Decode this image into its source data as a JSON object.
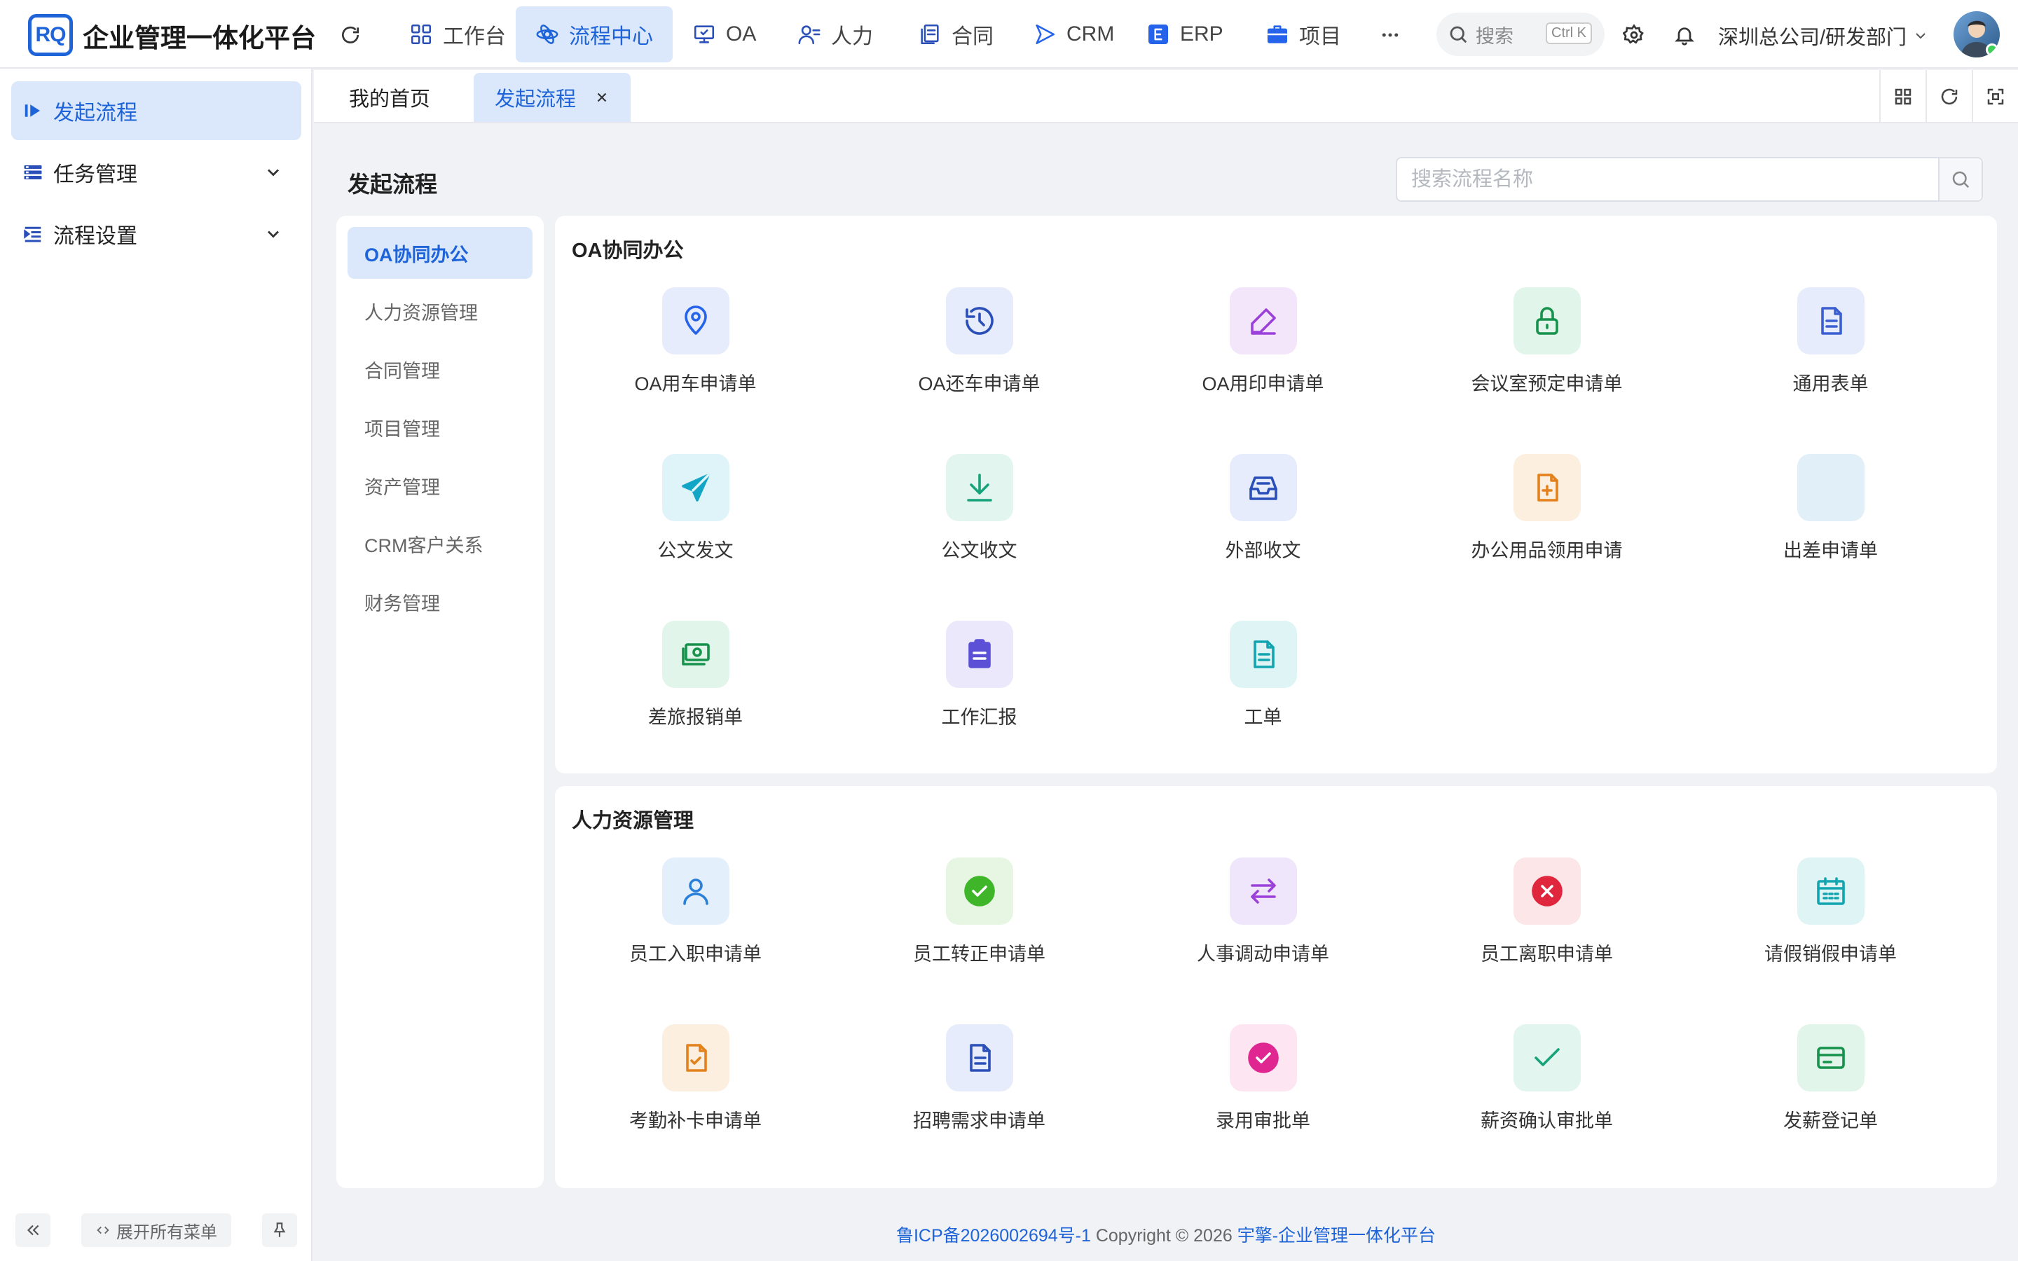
{
  "header": {
    "logo_text": "RQ",
    "title": "企业管理一体化平台",
    "nav": [
      {
        "label": "工作台",
        "icon": "dashboard-icon"
      },
      {
        "label": "流程中心",
        "icon": "workflow-icon",
        "active": true
      },
      {
        "label": "OA",
        "icon": "oa-icon"
      },
      {
        "label": "人力",
        "icon": "hr-icon"
      },
      {
        "label": "合同",
        "icon": "contract-icon"
      },
      {
        "label": "CRM",
        "icon": "crm-icon"
      },
      {
        "label": "ERP",
        "icon": "erp-icon"
      },
      {
        "label": "项目",
        "icon": "project-icon"
      }
    ],
    "search_label": "搜索",
    "search_shortcut": "Ctrl K",
    "org_label": "深圳总公司/研发部门"
  },
  "sidebar": {
    "items": [
      {
        "label": "发起流程",
        "active": true
      },
      {
        "label": "任务管理"
      },
      {
        "label": "流程设置"
      }
    ],
    "expand_all_label": "展开所有菜单"
  },
  "tabs": [
    {
      "label": "我的首页"
    },
    {
      "label": "发起流程",
      "active": true
    }
  ],
  "page": {
    "title": "发起流程",
    "search_placeholder": "搜索流程名称"
  },
  "categories": [
    {
      "label": "OA协同办公",
      "active": true
    },
    {
      "label": "人力资源管理"
    },
    {
      "label": "合同管理"
    },
    {
      "label": "项目管理"
    },
    {
      "label": "资产管理"
    },
    {
      "label": "CRM客户关系"
    },
    {
      "label": "财务管理"
    }
  ],
  "sections": [
    {
      "title": "OA协同办公",
      "items": [
        {
          "label": "OA用车申请单",
          "icon": "location-pin-icon",
          "color": "#2563eb",
          "bg": "#e6ecfb"
        },
        {
          "label": "OA还车申请单",
          "icon": "history-icon",
          "color": "#2a4fb8",
          "bg": "#e6ecfb"
        },
        {
          "label": "OA用印申请单",
          "icon": "pen-icon",
          "color": "#9b40d9",
          "bg": "#f3e6fb"
        },
        {
          "label": "会议室预定申请单",
          "icon": "lock-icon",
          "color": "#17924d",
          "bg": "#e2f5ea"
        },
        {
          "label": "通用表单",
          "icon": "document-icon",
          "color": "#3b5fd1",
          "bg": "#e6ecfb"
        },
        {
          "label": "公文发文",
          "icon": "paper-plane-icon",
          "color": "#12a5c6",
          "bg": "#def4f9"
        },
        {
          "label": "公文收文",
          "icon": "download-icon",
          "color": "#17a37a",
          "bg": "#e2f5ee"
        },
        {
          "label": "外部收文",
          "icon": "inbox-icon",
          "color": "#2a4fb8",
          "bg": "#e6ecfb"
        },
        {
          "label": "办公用品领用申请",
          "icon": "file-plus-icon",
          "color": "#e3811c",
          "bg": "#fcefe0"
        },
        {
          "label": "出差申请单",
          "icon": "blank-icon",
          "color": "#5aaad6",
          "bg": "#e1eff8"
        },
        {
          "label": "差旅报销单",
          "icon": "money-icon",
          "color": "#17924d",
          "bg": "#e2f5ea"
        },
        {
          "label": "工作汇报",
          "icon": "clipboard-icon",
          "color": "#5b50d6",
          "bg": "#ebe8fb"
        },
        {
          "label": "工单",
          "icon": "file-text-icon",
          "color": "#12a5b0",
          "bg": "#def4f5"
        }
      ]
    },
    {
      "title": "人力资源管理",
      "items": [
        {
          "label": "员工入职申请单",
          "icon": "user-icon",
          "color": "#2a7fd8",
          "bg": "#e3effb"
        },
        {
          "label": "员工转正申请单",
          "icon": "check-circle-icon",
          "color": "#3fb62a",
          "bg": "#e6f6e2"
        },
        {
          "label": "人事调动申请单",
          "icon": "swap-icon",
          "color": "#9b40d9",
          "bg": "#f0e6fb"
        },
        {
          "label": "员工离职申请单",
          "icon": "x-circle-icon",
          "color": "#e0263c",
          "bg": "#fde6e8"
        },
        {
          "label": "请假销假申请单",
          "icon": "calendar-icon",
          "color": "#12a5b0",
          "bg": "#def4f5"
        },
        {
          "label": "考勤补卡申请单",
          "icon": "file-check-icon",
          "color": "#e3811c",
          "bg": "#fcefe0"
        },
        {
          "label": "招聘需求申请单",
          "icon": "file-text-icon",
          "color": "#2a4fb8",
          "bg": "#e6ecfb"
        },
        {
          "label": "录用审批单",
          "icon": "check-circle-icon",
          "color": "#e02690",
          "bg": "#fde6f2"
        },
        {
          "label": "薪资确认审批单",
          "icon": "check-icon",
          "color": "#17a37a",
          "bg": "#e2f5ee"
        },
        {
          "label": "发薪登记单",
          "icon": "credit-card-icon",
          "color": "#17924d",
          "bg": "#e2f5ea"
        }
      ]
    }
  ],
  "footer": {
    "icp": "鲁ICP备2026002694号-1",
    "copyright": " Copyright © 2026 ",
    "brand": "宇擎-企业管理一体化平台"
  },
  "colors": {
    "accent": "#1e64d8",
    "accent_bg": "#dbe8fb",
    "page_bg": "#f0f2f5"
  }
}
